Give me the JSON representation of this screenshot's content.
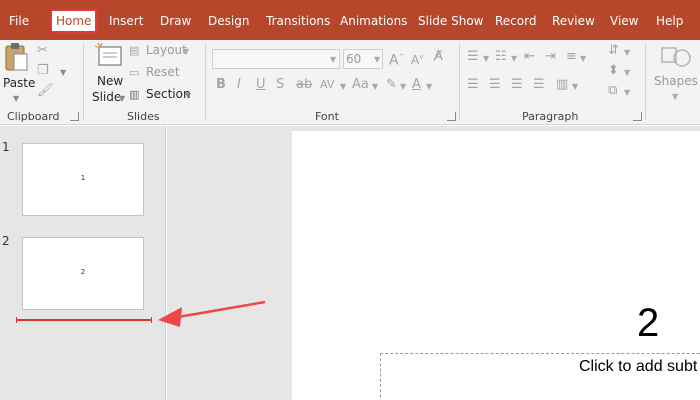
{
  "tabs": [
    {
      "label": "File",
      "active": false
    },
    {
      "label": "Home",
      "active": true
    },
    {
      "label": "Insert",
      "active": false
    },
    {
      "label": "Draw",
      "active": false
    },
    {
      "label": "Design",
      "active": false
    },
    {
      "label": "Transitions",
      "active": false
    },
    {
      "label": "Animations",
      "active": false
    },
    {
      "label": "Slide Show",
      "active": false
    },
    {
      "label": "Record",
      "active": false
    },
    {
      "label": "Review",
      "active": false
    },
    {
      "label": "View",
      "active": false
    },
    {
      "label": "Help",
      "active": false
    }
  ],
  "ribbon": {
    "clipboard": {
      "paste_label": "Paste",
      "group_label": "Clipboard"
    },
    "slides": {
      "new_slide_line1": "New",
      "new_slide_line2": "Slide",
      "layout_label": "Layout",
      "reset_label": "Reset",
      "section_label": "Section",
      "group_label": "Slides"
    },
    "font": {
      "font_name_value": "",
      "font_size_value": "60",
      "group_label": "Font"
    },
    "paragraph": {
      "group_label": "Paragraph"
    },
    "drawing": {
      "shapes_label": "Shapes"
    }
  },
  "thumbnails": [
    {
      "number": "1",
      "text": "1"
    },
    {
      "number": "2",
      "text": "2"
    }
  ],
  "slide": {
    "title_text": "2",
    "subtitle_placeholder": "Click to add subt"
  },
  "colors": {
    "accent": "#b7472a",
    "highlight": "#e3393d",
    "arrow": "#f04646"
  }
}
